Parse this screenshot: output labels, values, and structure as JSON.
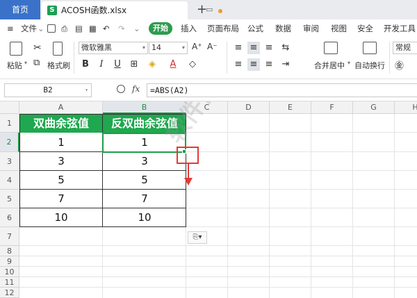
{
  "tabs": {
    "home": "首页",
    "file": "ACOSH函数.xlsx",
    "file_icon": "S",
    "add": "+"
  },
  "menu": {
    "file": "文件",
    "start": "开始",
    "items": [
      "插入",
      "页面布局",
      "公式",
      "数据",
      "审阅",
      "视图",
      "安全",
      "开发工具"
    ]
  },
  "ribbon": {
    "paste": "粘贴",
    "format_painter": "格式刷",
    "font_name": "微软雅黑",
    "font_size": "14",
    "bold": "B",
    "italic": "I",
    "underline": "U",
    "merge_center": "合并居中",
    "auto_wrap": "自动换行",
    "number_format": "常规",
    "increase_font": "A⁺",
    "decrease_font": "A⁻"
  },
  "formula_bar": {
    "name_box": "B2",
    "fx": "fx",
    "formula": "=ABS(A2)"
  },
  "columns": [
    "A",
    "B",
    "C",
    "D",
    "E",
    "F",
    "G",
    "H"
  ],
  "rows": [
    "1",
    "2",
    "3",
    "4",
    "5",
    "6",
    "7",
    "8",
    "9",
    "10",
    "11",
    "12"
  ],
  "table": {
    "headers": [
      "双曲余弦值",
      "反双曲余弦值"
    ],
    "rows": [
      [
        "1",
        "1"
      ],
      [
        "3",
        "3"
      ],
      [
        "5",
        "5"
      ],
      [
        "7",
        "7"
      ],
      [
        "10",
        "10"
      ]
    ]
  },
  "watermark": "软件自学网 RJZXW.COM",
  "colors": {
    "header_green": "#1fa84f",
    "active_green": "#1e9e48",
    "annotation_red": "#e53935",
    "home_tab_blue": "#3b72c9"
  }
}
